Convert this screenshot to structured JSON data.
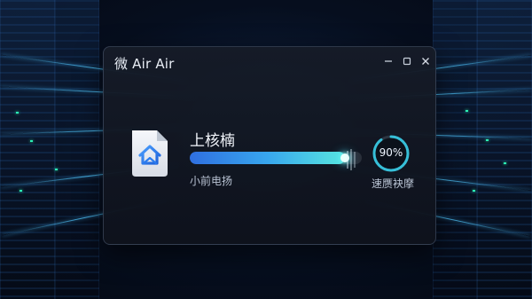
{
  "window": {
    "title": "微 Air Air",
    "controls": {
      "minimize_icon": "minimize-icon",
      "maximize_icon": "maximize-icon",
      "close_icon": "close-icon"
    }
  },
  "main": {
    "app_name": "上核楠",
    "file_icon": "document-folder-icon",
    "progress": {
      "value_percent": 90,
      "status": "小前电扬"
    },
    "gauge": {
      "value_percent": 90,
      "value_text": "90%",
      "label": "速赝袂摩"
    }
  },
  "colors": {
    "window_bg": "#161c28",
    "accent_blue": "#2f6fe0",
    "accent_cyan": "#58e6df",
    "text_primary": "#f2f5fb",
    "text_secondary": "#b8c2d2"
  }
}
